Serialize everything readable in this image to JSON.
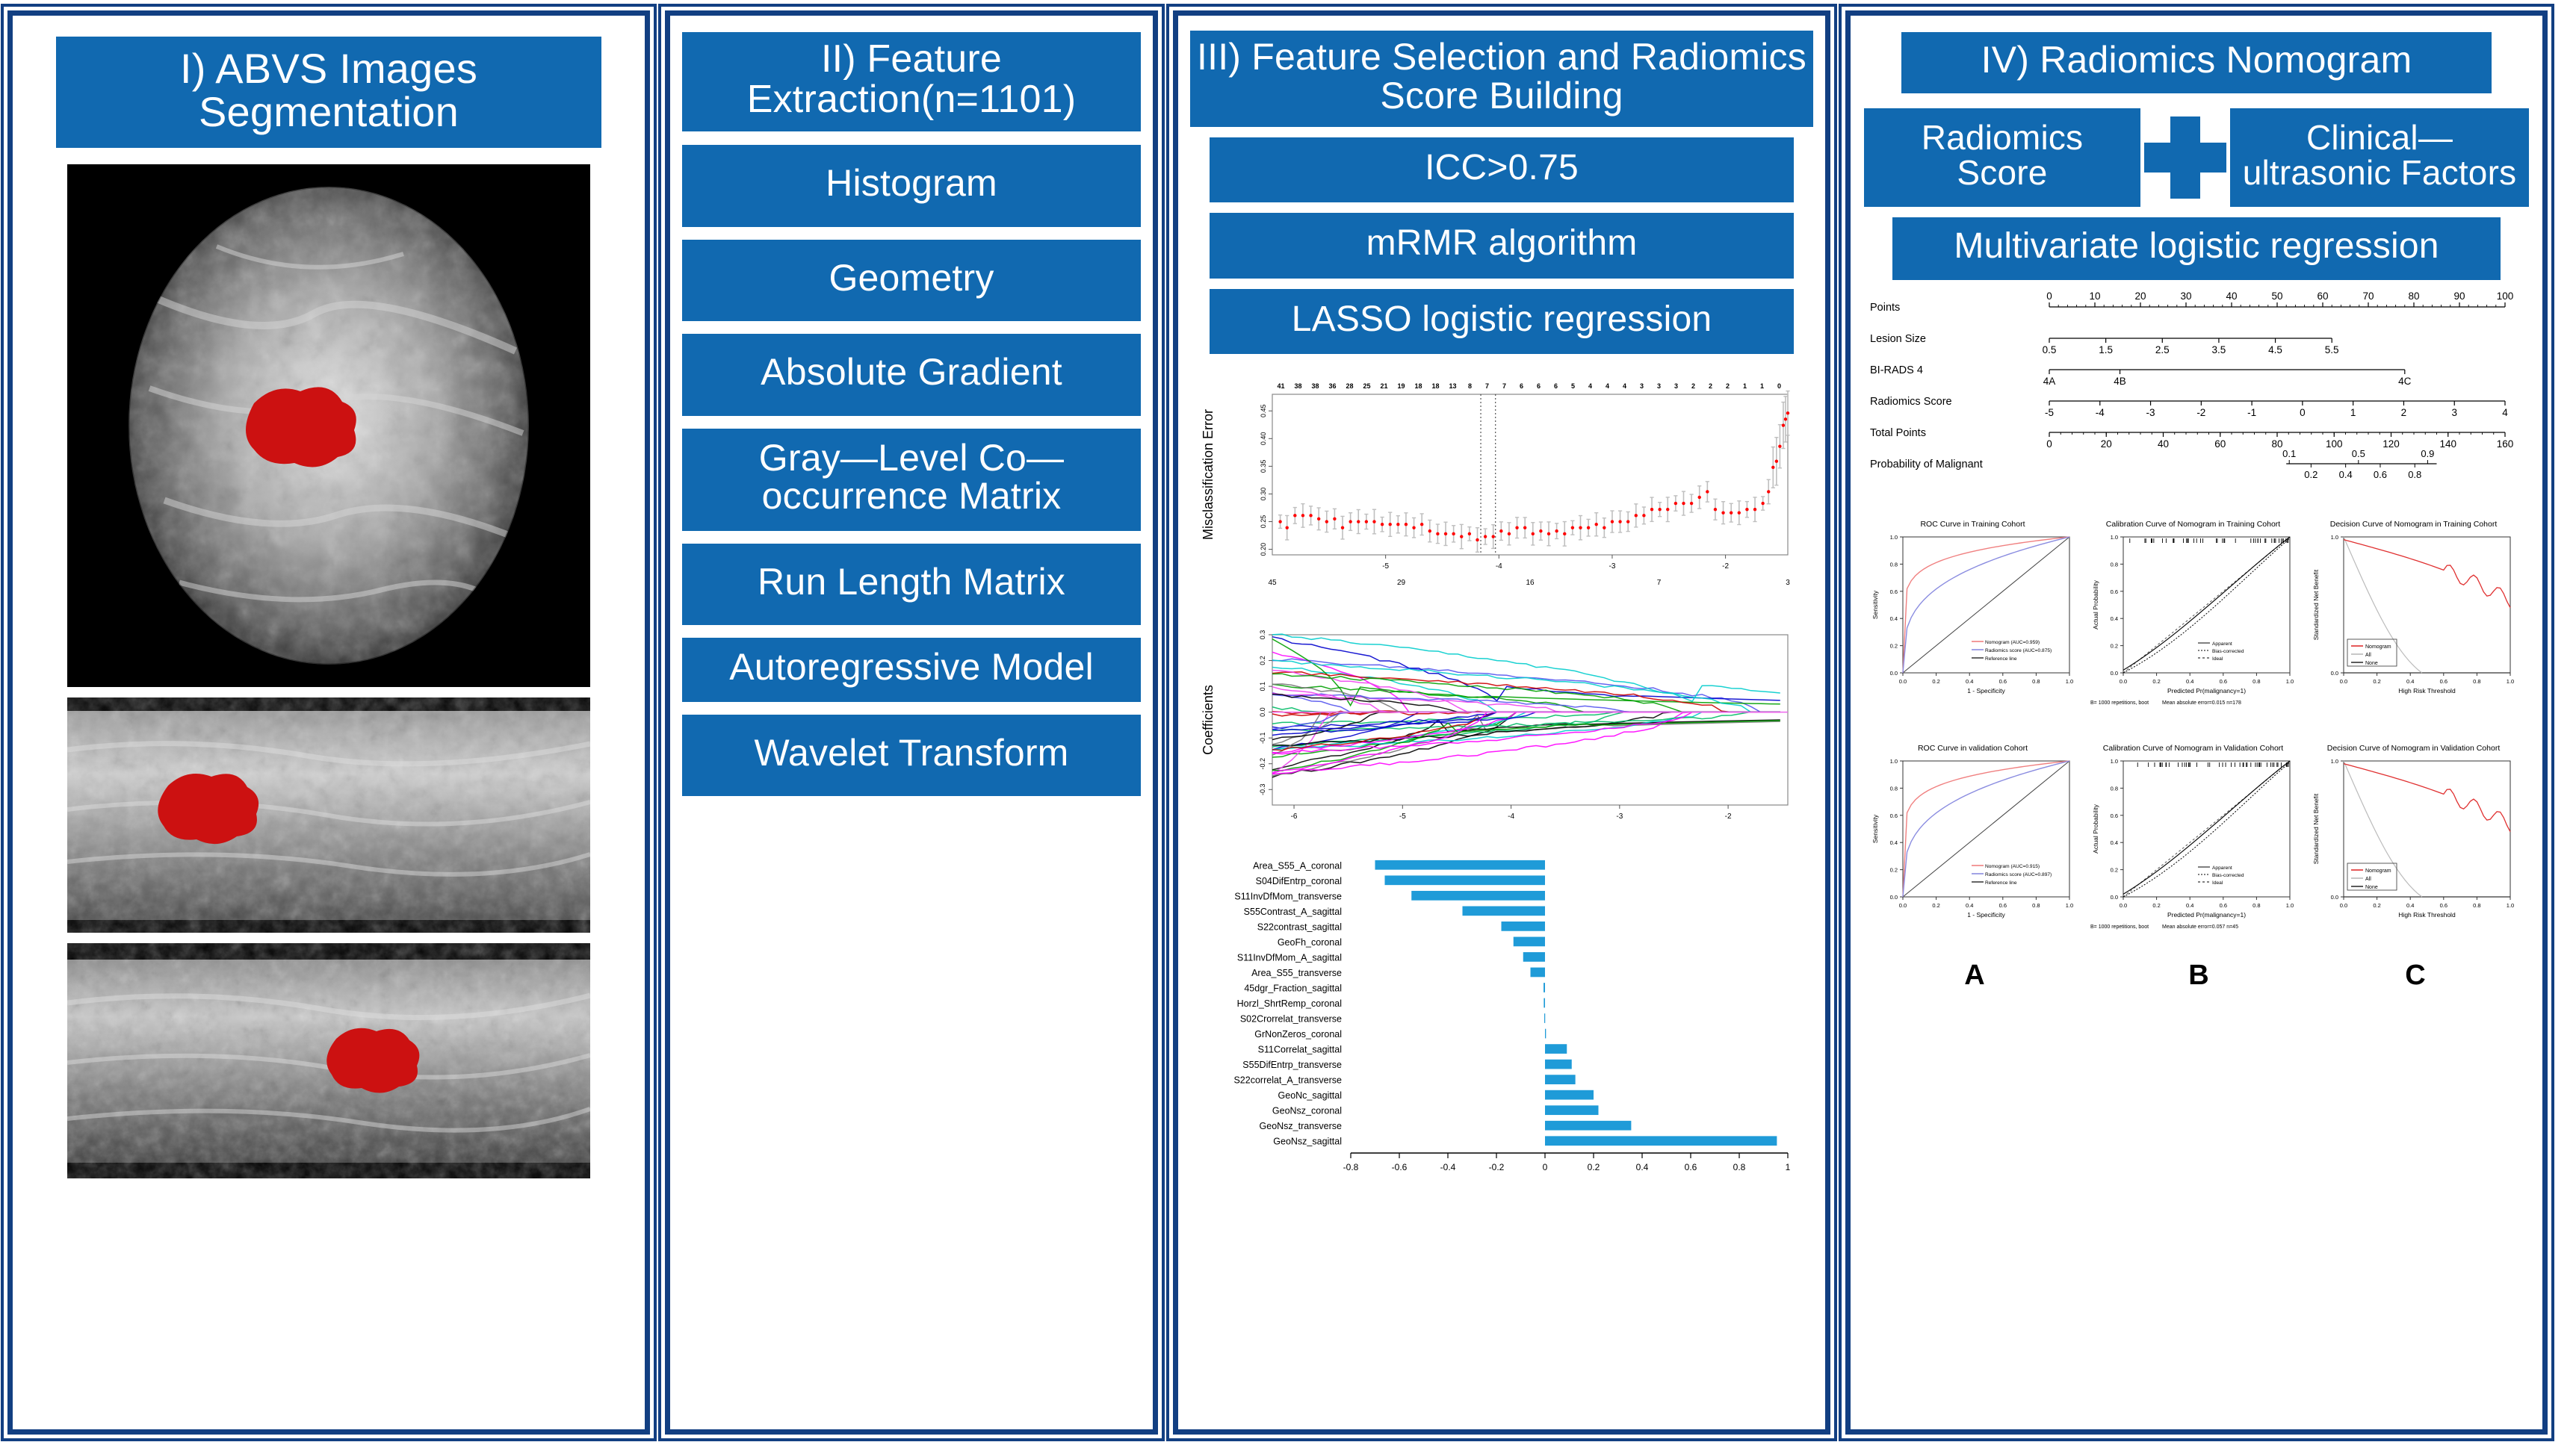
{
  "theme": {
    "blue": "#1169b0",
    "frame": "#123f82",
    "bar": "#1f9bd8",
    "red": "#cc1111"
  },
  "panel1": {
    "title": "I) ABVS Images Segmentation",
    "images": [
      {
        "name": "coronal-abvs-image",
        "view": "coronal"
      },
      {
        "name": "transverse-abvs-image",
        "view": "transverse"
      },
      {
        "name": "sagittal-abvs-image",
        "view": "sagittal"
      }
    ]
  },
  "panel2": {
    "title": "II) Feature Extraction(n=1101)",
    "features": [
      "Histogram",
      "Geometry",
      "Absolute Gradient",
      "Gray—Level Co—occurrence Matrix",
      "Run Length Matrix",
      "Autoregressive Model",
      "Wavelet Transform"
    ]
  },
  "panel3": {
    "title": "III) Feature Selection and Radiomics Score Building",
    "steps": [
      "ICC>0.75",
      "mRMR algorithm",
      "LASSO logistic regression"
    ]
  },
  "panel4": {
    "title": "IV) Radiomics Nomogram",
    "radiomics_score_label": "Radiomics Score",
    "plus_icon": "plus-icon",
    "clinical_label": "Clinical—ultrasonic Factors",
    "model_label": "Multivariate logistic regression",
    "panel_letters": [
      "A",
      "B",
      "C"
    ]
  },
  "chart_data": [
    {
      "id": "lasso-cv-plot",
      "type": "line",
      "title": "",
      "xlabel": "",
      "ylabel": "Misclassification Error",
      "xlim": [
        -6.0,
        -1.45
      ],
      "ylim": [
        0.19,
        0.48
      ],
      "xticks": [
        -5,
        -4,
        -3,
        -2
      ],
      "yticks": [
        0.2,
        0.25,
        0.3,
        0.35,
        0.4,
        0.45
      ],
      "top_axis_counts": [
        41,
        38,
        38,
        36,
        28,
        25,
        21,
        19,
        18,
        18,
        13,
        8,
        7,
        7,
        6,
        6,
        6,
        5,
        4,
        4,
        4,
        3,
        3,
        3,
        2,
        2,
        2,
        1,
        1,
        0
      ],
      "secondary_axis_counts": [
        45,
        29,
        16,
        7,
        3
      ],
      "vlines": [
        -4.16,
        -4.03
      ],
      "error_bar_color": "#bfbfbf",
      "point_color": "#ff0000",
      "points": [
        {
          "x": -5.93,
          "y": 0.25
        },
        {
          "x": -5.87,
          "y": 0.239
        },
        {
          "x": -5.8,
          "y": 0.261
        },
        {
          "x": -5.73,
          "y": 0.261
        },
        {
          "x": -5.66,
          "y": 0.261
        },
        {
          "x": -5.59,
          "y": 0.255
        },
        {
          "x": -5.52,
          "y": 0.25
        },
        {
          "x": -5.45,
          "y": 0.255
        },
        {
          "x": -5.38,
          "y": 0.239
        },
        {
          "x": -5.31,
          "y": 0.25
        },
        {
          "x": -5.24,
          "y": 0.25
        },
        {
          "x": -5.17,
          "y": 0.25
        },
        {
          "x": -5.1,
          "y": 0.25
        },
        {
          "x": -5.03,
          "y": 0.245
        },
        {
          "x": -4.96,
          "y": 0.245
        },
        {
          "x": -4.89,
          "y": 0.245
        },
        {
          "x": -4.82,
          "y": 0.245
        },
        {
          "x": -4.75,
          "y": 0.239
        },
        {
          "x": -4.68,
          "y": 0.245
        },
        {
          "x": -4.61,
          "y": 0.233
        },
        {
          "x": -4.54,
          "y": 0.228
        },
        {
          "x": -4.47,
          "y": 0.228
        },
        {
          "x": -4.4,
          "y": 0.228
        },
        {
          "x": -4.33,
          "y": 0.223
        },
        {
          "x": -4.26,
          "y": 0.228
        },
        {
          "x": -4.19,
          "y": 0.217
        },
        {
          "x": -4.12,
          "y": 0.223
        },
        {
          "x": -4.05,
          "y": 0.223
        },
        {
          "x": -3.98,
          "y": 0.233
        },
        {
          "x": -3.91,
          "y": 0.228
        },
        {
          "x": -3.84,
          "y": 0.239
        },
        {
          "x": -3.77,
          "y": 0.239
        },
        {
          "x": -3.7,
          "y": 0.228
        },
        {
          "x": -3.63,
          "y": 0.233
        },
        {
          "x": -3.56,
          "y": 0.228
        },
        {
          "x": -3.49,
          "y": 0.233
        },
        {
          "x": -3.42,
          "y": 0.228
        },
        {
          "x": -3.35,
          "y": 0.239
        },
        {
          "x": -3.28,
          "y": 0.239
        },
        {
          "x": -3.21,
          "y": 0.239
        },
        {
          "x": -3.14,
          "y": 0.245
        },
        {
          "x": -3.07,
          "y": 0.239
        },
        {
          "x": -3.0,
          "y": 0.25
        },
        {
          "x": -2.93,
          "y": 0.25
        },
        {
          "x": -2.86,
          "y": 0.25
        },
        {
          "x": -2.79,
          "y": 0.261
        },
        {
          "x": -2.72,
          "y": 0.261
        },
        {
          "x": -2.65,
          "y": 0.272
        },
        {
          "x": -2.58,
          "y": 0.272
        },
        {
          "x": -2.51,
          "y": 0.272
        },
        {
          "x": -2.44,
          "y": 0.283
        },
        {
          "x": -2.37,
          "y": 0.283
        },
        {
          "x": -2.3,
          "y": 0.283
        },
        {
          "x": -2.23,
          "y": 0.294
        },
        {
          "x": -2.16,
          "y": 0.304
        },
        {
          "x": -2.09,
          "y": 0.272
        },
        {
          "x": -2.02,
          "y": 0.266
        },
        {
          "x": -1.95,
          "y": 0.266
        },
        {
          "x": -1.88,
          "y": 0.266
        },
        {
          "x": -1.81,
          "y": 0.272
        },
        {
          "x": -1.74,
          "y": 0.272
        },
        {
          "x": -1.67,
          "y": 0.283
        },
        {
          "x": -1.62,
          "y": 0.304
        },
        {
          "x": -1.58,
          "y": 0.348
        },
        {
          "x": -1.55,
          "y": 0.359
        },
        {
          "x": -1.52,
          "y": 0.386
        },
        {
          "x": -1.49,
          "y": 0.424
        },
        {
          "x": -1.47,
          "y": 0.435
        },
        {
          "x": -1.45,
          "y": 0.446
        }
      ]
    },
    {
      "id": "lasso-coefficient-path-plot",
      "type": "line",
      "title": "",
      "xlabel": "",
      "ylabel": "Coefficients",
      "xlim": [
        -6.2,
        -1.45
      ],
      "ylim": [
        -0.36,
        0.3
      ],
      "xticks": [
        -6,
        -5,
        -4,
        -3,
        -2
      ],
      "yticks": [
        -0.3,
        -0.2,
        -0.1,
        0.0,
        0.1,
        0.2,
        0.3
      ],
      "top_axis_counts": [
        45,
        29,
        16,
        7,
        3
      ],
      "n_paths": 45,
      "palette": [
        "#000000",
        "#0000cd",
        "#00a000",
        "#00cccc",
        "#ff00ff",
        "#cc0000",
        "#777777",
        "#5555ee",
        "#00bb66",
        "#ee44ee"
      ]
    },
    {
      "id": "feature-coefficient-bar-chart",
      "type": "bar",
      "orientation": "horizontal",
      "title": "",
      "xlabel": "",
      "ylabel": "",
      "xlim": [
        -0.8,
        1.0
      ],
      "xticks": [
        -0.8,
        -0.6,
        -0.4,
        -0.2,
        0,
        0.2,
        0.4,
        0.6,
        0.8,
        1
      ],
      "bar_color": "#1f9bd8",
      "categories": [
        "Area_S55_A_coronal",
        "S04DifEntrp_coronal",
        "S11InvDfMom_transverse",
        "S55Contrast_A_sagittal",
        "S22contrast_sagittal",
        "GeoFh_coronal",
        "S11InvDfMom_A_sagittal",
        "Area_S55_transverse",
        "45dgr_Fraction_sagittal",
        "Horzl_ShrtRemp_coronal",
        "S02Crorrelat_transverse",
        "GrNonZeros_coronal",
        "S11Correlat_sagittal",
        "S55DifEntrp_transverse",
        "S22correlat_A_transverse",
        "GeoNc_sagittal",
        "GeoNsz_coronal",
        "GeoNsz_transverse",
        "GeoNsz_sagittal"
      ],
      "values": [
        -0.7,
        -0.66,
        -0.55,
        -0.34,
        -0.18,
        -0.13,
        -0.09,
        -0.06,
        -0.006,
        -0.005,
        -0.003,
        0.004,
        0.09,
        0.11,
        0.125,
        0.2,
        0.22,
        0.355,
        0.955
      ]
    },
    {
      "id": "nomogram",
      "type": "nomogram",
      "rows": [
        {
          "label": "Points",
          "ticks": [
            "0",
            "10",
            "20",
            "30",
            "40",
            "50",
            "60",
            "70",
            "80",
            "90",
            "100"
          ],
          "labels_above": true
        },
        {
          "label": "Lesion Size",
          "ticks": [
            "0.5",
            "1.5",
            "2.5",
            "3.5",
            "4.5",
            "5.5"
          ],
          "labels_above": false,
          "extent": 0.62
        },
        {
          "label": "BI-RADS 4",
          "ticks": [
            "4A",
            "4B",
            "4C"
          ],
          "labels_above": false,
          "extent": 0.78,
          "tick_pos": [
            0.0,
            0.155,
            0.78
          ]
        },
        {
          "label": "Radiomics Score",
          "ticks": [
            "-5",
            "-4",
            "-3",
            "-2",
            "-1",
            "0",
            "1",
            "2",
            "3",
            "4"
          ],
          "labels_above": false
        },
        {
          "label": "Total Points",
          "ticks": [
            "0",
            "20",
            "40",
            "60",
            "80",
            "100",
            "120",
            "140",
            "160"
          ],
          "labels_above": false
        },
        {
          "label": "Probability of Malignant",
          "ticks_above": [
            "0.1",
            "0.5",
            "0.9"
          ],
          "ticks_below": [
            "0.2",
            "0.4",
            "0.6",
            "0.8"
          ],
          "start": 0.52,
          "extent": 0.33
        }
      ]
    },
    {
      "id": "roc-training",
      "type": "line",
      "title": "ROC Curve in Training Cohort",
      "xlabel": "1 - Specificity",
      "ylabel": "Sensitivity",
      "xlim": [
        0,
        1
      ],
      "ylim": [
        0,
        1
      ],
      "xticks": [
        0.0,
        0.2,
        0.4,
        0.6,
        0.8,
        1.0
      ],
      "yticks": [
        0.0,
        0.2,
        0.4,
        0.6,
        0.8,
        1.0
      ],
      "legend": [
        {
          "label": "Nomogram (AUC=0.959)",
          "color": "#f08080"
        },
        {
          "label": "Radiomics score (AUC=0.875)",
          "color": "#8a8ce0"
        },
        {
          "label": "Reference line",
          "color": "#404040"
        }
      ]
    },
    {
      "id": "calibration-training",
      "type": "line",
      "title": "Calibration Curve of Nomogram in Training Cohort",
      "xlabel": "Predicted Pr(malignancy=1)",
      "ylabel": "Actual Probability",
      "xlim": [
        0,
        1
      ],
      "ylim": [
        0,
        1
      ],
      "xticks": [
        0.0,
        0.2,
        0.4,
        0.6,
        0.8,
        1.0
      ],
      "yticks": [
        0.0,
        0.2,
        0.4,
        0.6,
        0.8,
        1.0
      ],
      "footnote_left": "B= 1000 repetitions, boot",
      "footnote_right": "Mean absolute error=0.015 n=178",
      "legend": [
        "Apparent",
        "Bias-corrected",
        "Ideal"
      ]
    },
    {
      "id": "decision-training",
      "type": "line",
      "title": "Decision Curve of  Nomogram in Training Cohort",
      "xlabel": "High Risk Threshold",
      "ylabel": "Standardized Net Benefit",
      "xlim": [
        0,
        1
      ],
      "ylim": [
        0,
        1
      ],
      "xticks": [
        0.0,
        0.2,
        0.4,
        0.6,
        0.8,
        1.0
      ],
      "yticks": [
        0.0,
        1.0
      ],
      "legend": [
        {
          "label": "Nomogram",
          "color": "#e03030"
        },
        {
          "label": "All",
          "color": "#bbbbbb"
        },
        {
          "label": "None",
          "color": "#333333"
        }
      ]
    },
    {
      "id": "roc-validation",
      "type": "line",
      "title": "ROC Curve in validation Cohort",
      "xlabel": "1 - Specificity",
      "ylabel": "Sensitivity",
      "xlim": [
        0,
        1
      ],
      "ylim": [
        0,
        1
      ],
      "xticks": [
        0.0,
        0.2,
        0.4,
        0.6,
        0.8,
        1.0
      ],
      "yticks": [
        0.0,
        0.2,
        0.4,
        0.6,
        0.8,
        1.0
      ],
      "legend": [
        {
          "label": "Nomogram (AUC=0.915)",
          "color": "#f08080"
        },
        {
          "label": "Radiomics score (AUC=0.897)",
          "color": "#8a8ce0"
        },
        {
          "label": "Reference line",
          "color": "#404040"
        }
      ]
    },
    {
      "id": "calibration-validation",
      "type": "line",
      "title": "Calibration Curve of Nomogram in Validation Cohort",
      "xlabel": "Predicted Pr(malignancy=1)",
      "ylabel": "Actual Probability",
      "xlim": [
        0,
        1
      ],
      "ylim": [
        0,
        1
      ],
      "xticks": [
        0.0,
        0.2,
        0.4,
        0.6,
        0.8,
        1.0
      ],
      "yticks": [
        0.0,
        0.2,
        0.4,
        0.6,
        0.8,
        1.0
      ],
      "footnote_left": "B= 1000 repetitions, boot",
      "footnote_right": "Mean absolute error=0.057 n=45",
      "legend": [
        "Apparent",
        "Bias-corrected",
        "Ideal"
      ]
    },
    {
      "id": "decision-validation",
      "type": "line",
      "title": "Decision Curve of  Nomogram in Validation Cohort",
      "xlabel": "High Risk Threshold",
      "ylabel": "Standardized Net Benefit",
      "xlim": [
        0,
        1
      ],
      "ylim": [
        0,
        1
      ],
      "xticks": [
        0.0,
        0.2,
        0.4,
        0.6,
        0.8,
        1.0
      ],
      "yticks": [
        0.0,
        1.0
      ],
      "legend": [
        {
          "label": "Nomogram",
          "color": "#e03030"
        },
        {
          "label": "All",
          "color": "#bbbbbb"
        },
        {
          "label": "None",
          "color": "#333333"
        }
      ]
    }
  ]
}
